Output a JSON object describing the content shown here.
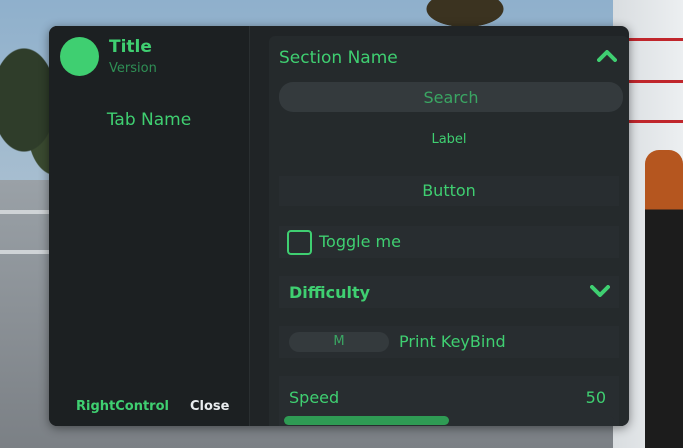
{
  "window": {
    "title": "Title",
    "version": "Version",
    "accent_color": "#3fcf71"
  },
  "sidebar": {
    "tabs": [
      {
        "label": "Tab Name"
      }
    ],
    "toggle_key": "RightControl",
    "close_label": "Close"
  },
  "section": {
    "title": "Section Name",
    "collapse_icon": "chevron-up-icon"
  },
  "search": {
    "placeholder": "Search"
  },
  "label": {
    "text": "Label"
  },
  "button": {
    "label": "Button"
  },
  "toggle": {
    "label": "Toggle me",
    "checked": false
  },
  "dropdown": {
    "label": "Difficulty",
    "icon": "chevron-down-icon"
  },
  "keybind": {
    "key": "M",
    "label": "Print KeyBind"
  },
  "slider": {
    "label": "Speed",
    "value": "50",
    "fill_fraction": 0.5
  }
}
